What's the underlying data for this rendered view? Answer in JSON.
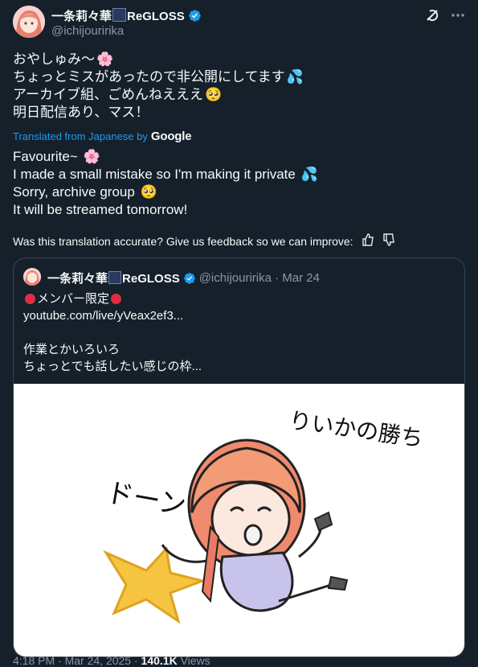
{
  "author": {
    "display_name": "一条莉々華",
    "group_name": "ReGLOSS",
    "handle": "@ichijouririka"
  },
  "colors": {
    "background": "#15202b",
    "accent_blue": "#1d9bf0",
    "muted_text": "#8b98a5",
    "border": "#38444d"
  },
  "icons": {
    "top_right": [
      "grok-icon",
      "more-options-icon"
    ],
    "verified": "verified-badge-icon",
    "feedback": [
      "thumbs-up-icon",
      "thumbs-down-icon"
    ]
  },
  "original_text": {
    "line1": "おやしゅみ～",
    "line1_emoji": "🌸",
    "line2": "ちょっとミスがあったので非公開にしてます",
    "line2_emoji": "💦",
    "line3": "アーカイブ組、ごめんねえええ",
    "line3_emoji": "🥺",
    "line4": "明日配信あり、マス！"
  },
  "translation": {
    "label": "Translated from Japanese by",
    "provider": "Google",
    "line1": "Favourite~",
    "line1_emoji": "🌸",
    "line2": "I made a small mistake so I'm making it private",
    "line2_emoji": "💦",
    "line3": "Sorry, archive group",
    "line3_emoji": "🥺",
    "line4": "It will be streamed tomorrow!"
  },
  "feedback": {
    "prompt": "Was this translation accurate? Give us feedback so we can improve:"
  },
  "quoted_post": {
    "display_name": "一条莉々華",
    "group_name": "ReGLOSS",
    "meta": "@ichijouririka · Mar 24",
    "line1": "メンバー限定",
    "line2": "youtube.com/live/yVeax2ef3...",
    "line3": "",
    "line4": "作業とかいろいろ",
    "line5": "ちょっとでも話したい感じの枠...",
    "image_text_left": "ドーンッ",
    "image_text_right": "りいかの勝ち"
  },
  "footer": {
    "time": "4:18 PM",
    "date": "Mar 24, 2025",
    "views_count": "140.1K",
    "views_label": "Views",
    "separator": "·"
  }
}
